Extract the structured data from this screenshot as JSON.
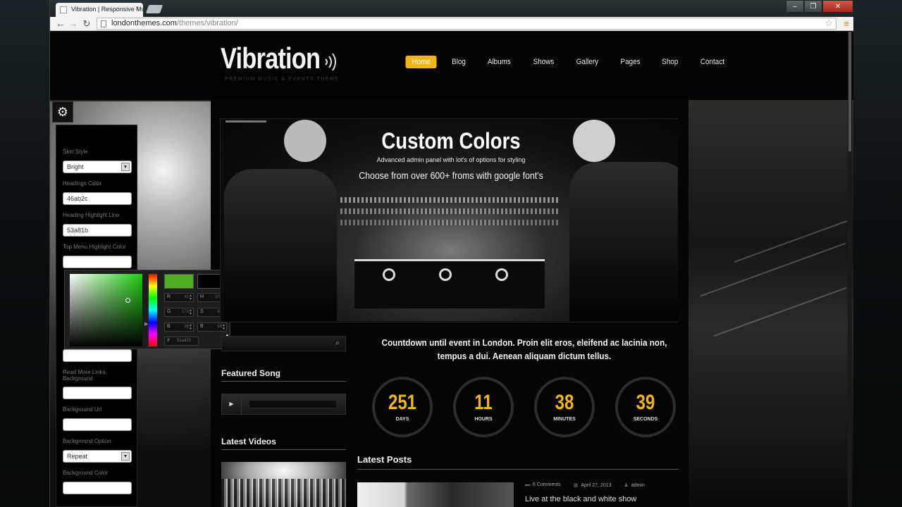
{
  "browser": {
    "tab_title": "Vibration | Responsive Mu",
    "tab_close": "×",
    "url_host": "londonthemes.com",
    "url_path": "/themes/vibration/",
    "window_controls": [
      "–",
      "❐",
      "✕"
    ],
    "nav_back": "←",
    "nav_forward": "→",
    "nav_reload": "↻",
    "bookmark_icon": "star-icon",
    "menu_icon": "hamburger-icon"
  },
  "site": {
    "logo": "Vibration",
    "tagline": "PREMIUM MUSIC & EVENTS THEME",
    "nav": [
      "Home",
      "Blog",
      "Albums",
      "Shows",
      "Gallery",
      "Pages",
      "Shop",
      "Contact"
    ],
    "active_nav": "Home",
    "accent_color": "#f2b516"
  },
  "style_panel": {
    "skin_style_label": "Skin Style",
    "skin_style_value": "Bright",
    "headings_color_label": "Headings Color",
    "headings_color_value": "46ab2c",
    "heading_highlight_label": "Heading Highlight Line",
    "heading_highlight_value": "53a81b",
    "top_menu_highlight_label": "Top Menu Highlight Color",
    "top_menu_highlight_value": "",
    "read_more_label": "Read More Links Background",
    "read_more_value": "",
    "background_url_label": "Background Url",
    "background_url_value": "",
    "background_option_label": "Background Option",
    "background_option_value": "Repeat",
    "background_color_label": "Background Color",
    "background_color_value": ""
  },
  "color_picker": {
    "new_color": "#51ad23",
    "old_color": "#000000",
    "r_label": "R",
    "r": "81",
    "g_label": "G",
    "g": "173",
    "b_label": "B",
    "b": "36",
    "h_label": "H",
    "h": "100",
    "s_label": "S",
    "s": "80",
    "bri_label": "B",
    "bri": "68",
    "hex_label": "#",
    "hex": "51ad23"
  },
  "slider": {
    "title": "Custom Colors",
    "subtitle": "Advanced admin panel with lot's of options for styling",
    "subtitle2": "Choose from over 600+ froms with google font's"
  },
  "sidebar": {
    "featured_song": "Featured Song",
    "latest_videos": "Latest Videos",
    "play_icon": "▶"
  },
  "countdown": {
    "text": "Countdown until event in London. Proin elit eros, eleifend ac lacinia non, tempus a dui. Aenean aliquam dictum tellus.",
    "items": [
      {
        "value": "251",
        "unit": "DAYS"
      },
      {
        "value": "11",
        "unit": "HOURS"
      },
      {
        "value": "38",
        "unit": "MINUTES"
      },
      {
        "value": "39",
        "unit": "SECONDS"
      }
    ]
  },
  "posts": {
    "heading": "Latest Posts",
    "comments": "6 Comments",
    "date": "April 27, 2013",
    "author": "admin",
    "title": "Live at the black and white show"
  }
}
